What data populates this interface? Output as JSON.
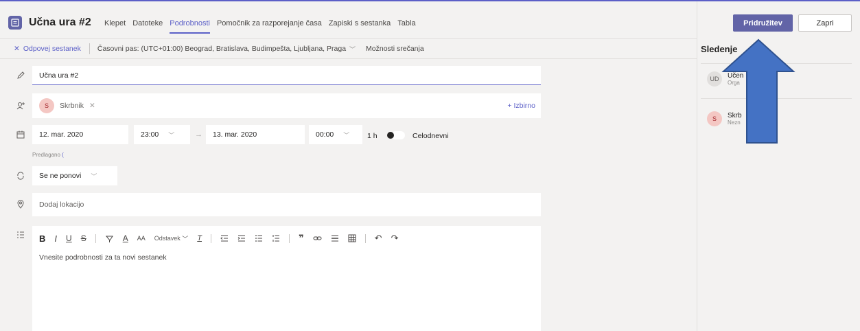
{
  "header": {
    "title": "Učna ura #2",
    "tabs": [
      {
        "label": "Klepet",
        "active": false
      },
      {
        "label": "Datoteke",
        "active": false
      },
      {
        "label": "Podrobnosti",
        "active": true
      },
      {
        "label": "Pomočnik za razporejanje časa",
        "active": false
      },
      {
        "label": "Zapiski s sestanka",
        "active": false
      },
      {
        "label": "Tabla",
        "active": false
      }
    ],
    "join_label": "Pridružitev",
    "close_label": "Zapri",
    "accent_color": "#6264a7"
  },
  "commandbar": {
    "cancel_label": "Odpovej sestanek",
    "timezone_label": "Časovni pas: (UTC+01:00) Beograd, Bratislava, Budimpešta, Ljubljana, Praga",
    "options_label": "Možnosti srečanja"
  },
  "form": {
    "title_value": "Učna ura #2",
    "attendee": {
      "initial": "S",
      "name": "Skrbnik"
    },
    "optional_label": "+ Izbirno",
    "start_date": "12. mar. 2020",
    "start_time": "23:00",
    "end_date": "13. mar. 2020",
    "end_time": "00:00",
    "duration": "1 h",
    "allday_label": "Celodnevni",
    "suggested_label": "Predlagano",
    "repeat_value": "Se ne ponovi",
    "location_placeholder": "Dodaj lokacijo",
    "editor": {
      "paragraph_label": "Odstavek",
      "placeholder": "Vnesite podrobnosti za ta novi sestanek"
    }
  },
  "tracking": {
    "title": "Sledenje",
    "people": [
      {
        "initials": "UD",
        "name": "Učen",
        "role": "Orga"
      },
      {
        "initials": "S",
        "name": "Skrb",
        "role": "Nezn"
      }
    ]
  }
}
